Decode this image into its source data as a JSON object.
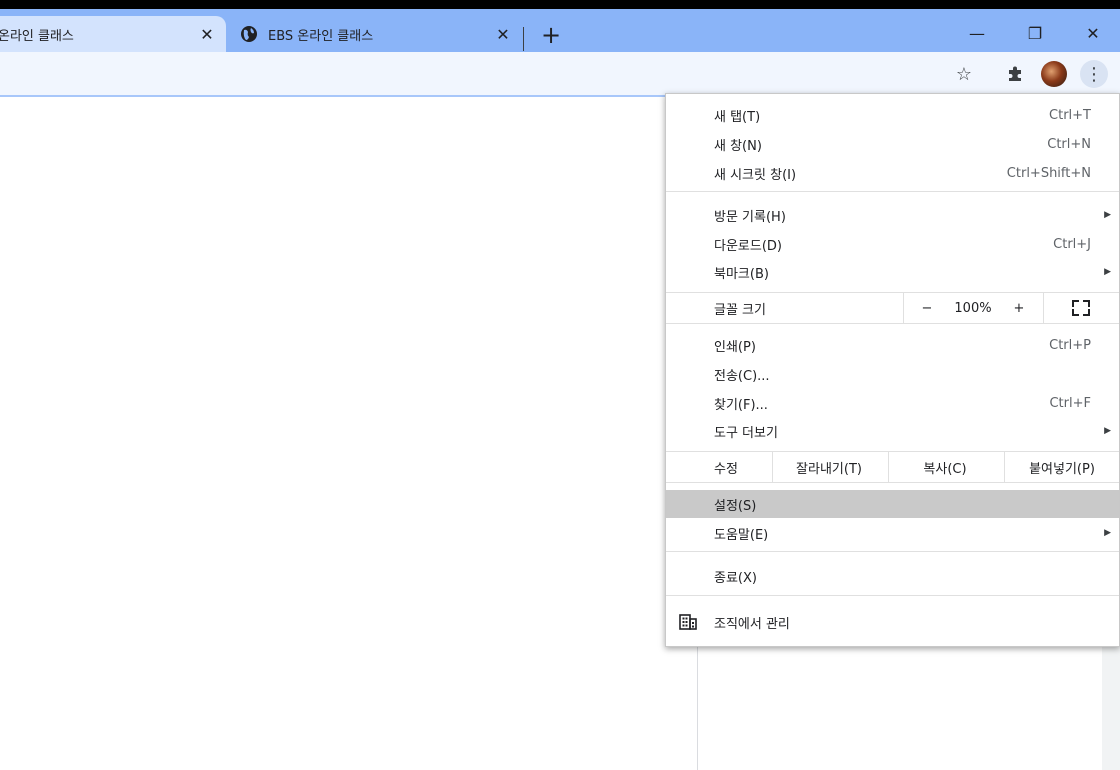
{
  "tabs": [
    {
      "title": "온라인 클래스",
      "close": "✕",
      "active": true
    },
    {
      "title": "EBS 온라인 클래스",
      "close": "✕",
      "active": false
    }
  ],
  "new_tab_label": "+",
  "window_controls": {
    "minimize": "—",
    "restore": "❐",
    "close": "✕"
  },
  "toolbar": {
    "bookmark_icon": "☆",
    "extensions_icon": "puzzle-icon",
    "menu_icon": "⋮"
  },
  "menu": {
    "group1": [
      {
        "label": "새 탭(T)",
        "shortcut": "Ctrl+T"
      },
      {
        "label": "새 창(N)",
        "shortcut": "Ctrl+N"
      },
      {
        "label": "새 시크릿 창(I)",
        "shortcut": "Ctrl+Shift+N"
      }
    ],
    "group2": [
      {
        "label": "방문 기록(H)",
        "shortcut": "",
        "submenu": true
      },
      {
        "label": "다운로드(D)",
        "shortcut": "Ctrl+J",
        "submenu": false
      },
      {
        "label": "북마크(B)",
        "shortcut": "",
        "submenu": true
      }
    ],
    "zoom": {
      "label": "글꼴 크기",
      "minus": "−",
      "value": "100%",
      "plus": "+"
    },
    "group3": [
      {
        "label": "인쇄(P)",
        "shortcut": "Ctrl+P"
      },
      {
        "label": "전송(C)...",
        "shortcut": ""
      },
      {
        "label": "찾기(F)...",
        "shortcut": "Ctrl+F"
      },
      {
        "label": "도구 더보기",
        "shortcut": "",
        "submenu": true
      }
    ],
    "edit": {
      "label": "수정",
      "cut": "잘라내기(T)",
      "copy": "복사(C)",
      "paste": "붙여넣기(P)"
    },
    "group4": [
      {
        "label": "설정(S)",
        "highlighted": true
      },
      {
        "label": "도움말(E)",
        "submenu": true
      }
    ],
    "exit": "종료(X)",
    "managed": "조직에서 관리"
  },
  "colors": {
    "tabstrip": "#8ab4f8",
    "active_tab": "#d3e3fd",
    "toolbar": "#f1f6fe",
    "highlight": "#c9c9c9"
  }
}
